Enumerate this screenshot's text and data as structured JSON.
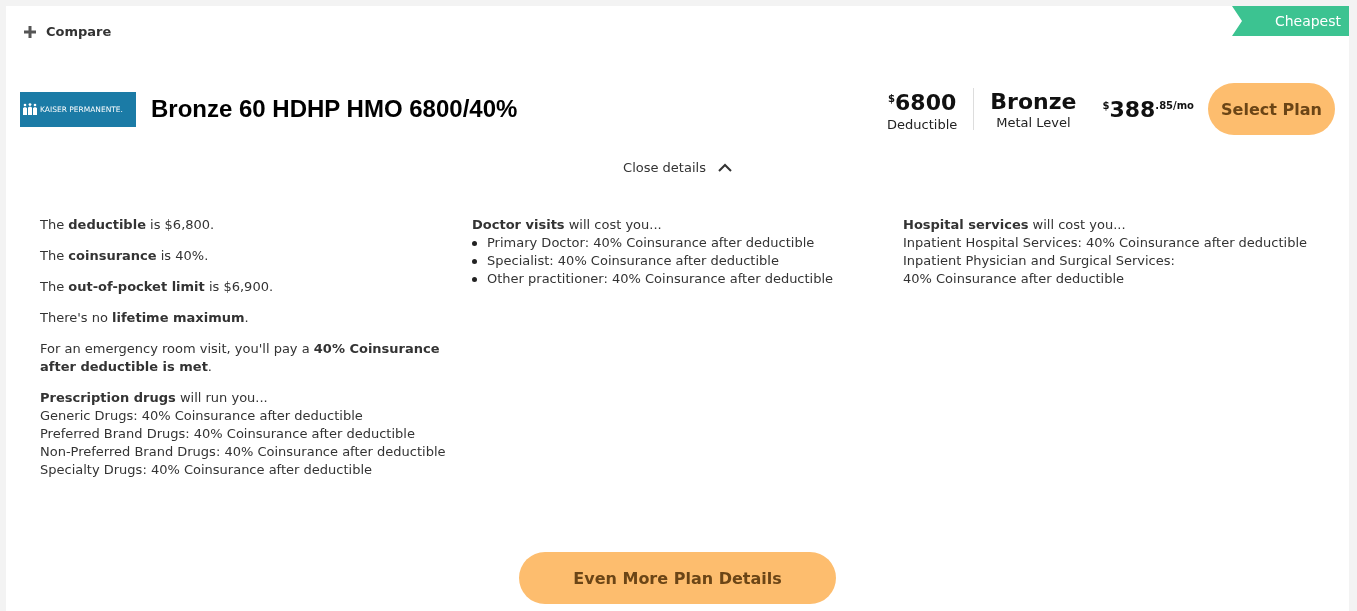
{
  "compare": {
    "label": "Compare"
  },
  "badge": {
    "label": "Cheapest"
  },
  "plan": {
    "logo": "KAISER PERMANENTE.",
    "name": "Bronze 60 HDHP HMO 6800/40%"
  },
  "deductible": {
    "currency": "$",
    "amount": "6800",
    "label": "Deductible"
  },
  "metal": {
    "value": "Bronze",
    "label": "Metal Level"
  },
  "premium": {
    "currency": "$",
    "dollars": "388",
    "cents": ".85/mo"
  },
  "select_button": "Select Plan",
  "details_toggle": {
    "label": "Close details",
    "expanded": true
  },
  "summary": [
    "The **deductible** is $6,800.",
    "The **coinsurance** is 40%.",
    "The **out-of-pocket limit** is $6,900.",
    "There's no **lifetime maximum**.",
    "For an emergency room visit, you'll pay a **40% Coinsurance after deductible is met**."
  ],
  "prescriptions": {
    "heading": "**Prescription drugs** will run you...",
    "lines": [
      "Generic Drugs: 40% Coinsurance after deductible",
      "Preferred Brand Drugs: 40% Coinsurance after deductible",
      "Non-Preferred Brand Drugs: 40% Coinsurance after deductible",
      "Specialty Drugs: 40% Coinsurance after deductible"
    ]
  },
  "doctor_visits": {
    "heading": "**Doctor visits** will cost you...",
    "items": [
      "Primary Doctor: 40% Coinsurance after deductible",
      "Specialist: 40% Coinsurance after deductible",
      "Other practitioner: 40% Coinsurance after deductible"
    ]
  },
  "hospital_services": {
    "heading": "**Hospital services** will cost you...",
    "lines": [
      "Inpatient Hospital Services: 40% Coinsurance after deductible",
      "Inpatient Physician and Surgical Services:",
      "40% Coinsurance after deductible"
    ]
  },
  "more_button": "Even More Plan Details"
}
